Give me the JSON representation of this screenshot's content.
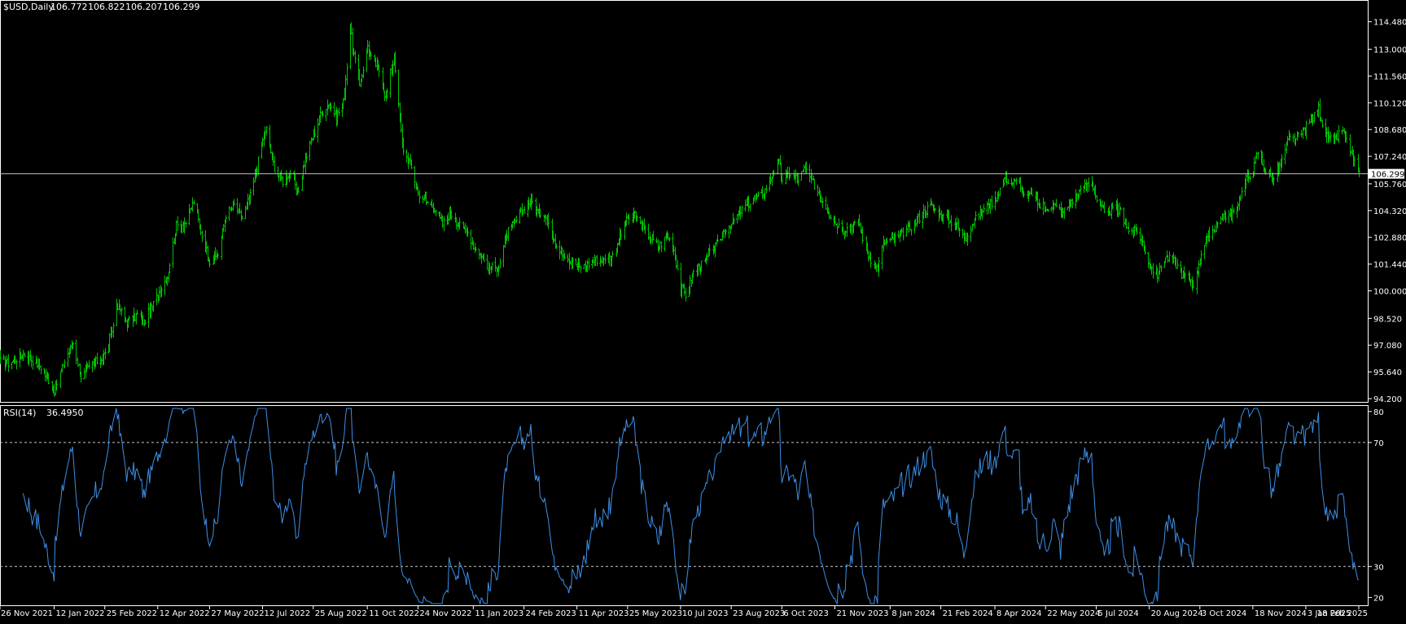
{
  "header": {
    "symbol_label": "$USD,Daily",
    "open": "106.772",
    "high": "106.822",
    "low": "106.207",
    "close": "106.299"
  },
  "indicator": {
    "label": "RSI(14)",
    "value": "36.4950"
  },
  "colors": {
    "background": "#000000",
    "bars": "#00c000",
    "rsi_line": "#3d8fe6",
    "axis": "#ffffff",
    "grid_levels": "#c8c8c8"
  },
  "chart_data": [
    {
      "type": "ohlc",
      "series_name": "$USD,Daily",
      "x_labels": [
        "26 Nov 2021",
        "12 Jan 2022",
        "25 Feb 2022",
        "12 Apr 2022",
        "27 May 2022",
        "12 Jul 2022",
        "25 Aug 2022",
        "11 Oct 2022",
        "24 Nov 2022",
        "11 Jan 2023",
        "24 Feb 2023",
        "11 Apr 2023",
        "25 May 2023",
        "10 Jul 2023",
        "23 Aug 2023",
        "6 Oct 2023",
        "21 Nov 2023",
        "8 Jan 2024",
        "21 Feb 2024",
        "8 Apr 2024",
        "22 May 2024",
        "5 Jul 2024",
        "20 Aug 2024",
        "3 Oct 2024",
        "18 Nov 2024",
        "3 Jan 2025",
        "18 Feb 2025"
      ],
      "y_ticks": [
        "114.480",
        "113.000",
        "111.560",
        "110.120",
        "108.680",
        "107.240",
        "105.760",
        "104.320",
        "102.880",
        "101.440",
        "100.000",
        "98.520",
        "97.080",
        "95.640",
        "94.200"
      ],
      "ylim": [
        94.2,
        115.3
      ],
      "current_price": "106.299",
      "close_anchors": [
        [
          "26 Nov 2021",
          96.2
        ],
        [
          "3 Dec 2021",
          96.1
        ],
        [
          "17 Dec 2021",
          96.6
        ],
        [
          "31 Dec 2021",
          95.9
        ],
        [
          "12 Jan 2022",
          94.7
        ],
        [
          "21 Jan 2022",
          96.2
        ],
        [
          "28 Jan 2022",
          97.2
        ],
        [
          "4 Feb 2022",
          95.4
        ],
        [
          "14 Feb 2022",
          96.0
        ],
        [
          "25 Feb 2022",
          96.6
        ],
        [
          "4 Mar 2022",
          98.1
        ],
        [
          "7 Mar 2022",
          99.3
        ],
        [
          "16 Mar 2022",
          98.3
        ],
        [
          "25 Mar 2022",
          98.7
        ],
        [
          "31 Mar 2022",
          98.3
        ],
        [
          "12 Apr 2022",
          99.8
        ],
        [
          "20 Apr 2022",
          100.8
        ],
        [
          "28 Apr 2022",
          103.5
        ],
        [
          "6 May 2022",
          103.7
        ],
        [
          "13 May 2022",
          104.8
        ],
        [
          "20 May 2022",
          103.0
        ],
        [
          "27 May 2022",
          101.6
        ],
        [
          "3 Jun 2022",
          102.0
        ],
        [
          "10 Jun 2022",
          104.1
        ],
        [
          "17 Jun 2022",
          104.6
        ],
        [
          "24 Jun 2022",
          103.9
        ],
        [
          "1 Jul 2022",
          105.1
        ],
        [
          "12 Jul 2022",
          108.1
        ],
        [
          "15 Jul 2022",
          108.7
        ],
        [
          "22 Jul 2022",
          106.6
        ],
        [
          "29 Jul 2022",
          105.9
        ],
        [
          "5 Aug 2022",
          106.4
        ],
        [
          "11 Aug 2022",
          105.1
        ],
        [
          "17 Aug 2022",
          106.9
        ],
        [
          "25 Aug 2022",
          108.4
        ],
        [
          "1 Sep 2022",
          109.6
        ],
        [
          "7 Sep 2022",
          110.1
        ],
        [
          "14 Sep 2022",
          109.4
        ],
        [
          "20 Sep 2022",
          110.1
        ],
        [
          "26 Sep 2022",
          114.2
        ],
        [
          "28 Sep 2022",
          113.0
        ],
        [
          "4 Oct 2022",
          111.1
        ],
        [
          "11 Oct 2022",
          113.2
        ],
        [
          "13 Oct 2022",
          112.6
        ],
        [
          "21 Oct 2022",
          111.9
        ],
        [
          "27 Oct 2022",
          110.4
        ],
        [
          "3 Nov 2022",
          112.7
        ],
        [
          "10 Nov 2022",
          107.8
        ],
        [
          "17 Nov 2022",
          106.8
        ],
        [
          "24 Nov 2022",
          105.3
        ],
        [
          "1 Dec 2022",
          104.8
        ],
        [
          "8 Dec 2022",
          104.5
        ],
        [
          "15 Dec 2022",
          103.6
        ],
        [
          "22 Dec 2022",
          104.2
        ],
        [
          "30 Dec 2022",
          103.5
        ],
        [
          "6 Jan 2023",
          103.2
        ],
        [
          "11 Jan 2023",
          102.4
        ],
        [
          "18 Jan 2023",
          101.8
        ],
        [
          "25 Jan 2023",
          101.2
        ],
        [
          "2 Feb 2023",
          101.3
        ],
        [
          "9 Feb 2023",
          103.1
        ],
        [
          "16 Feb 2023",
          103.7
        ],
        [
          "24 Feb 2023",
          104.4
        ],
        [
          "2 Mar 2023",
          104.9
        ],
        [
          "8 Mar 2023",
          104.2
        ],
        [
          "15 Mar 2023",
          104.1
        ],
        [
          "22 Mar 2023",
          102.6
        ],
        [
          "29 Mar 2023",
          102.1
        ],
        [
          "5 Apr 2023",
          101.6
        ],
        [
          "11 Apr 2023",
          101.4
        ],
        [
          "14 Apr 2023",
          101.3
        ],
        [
          "20 Apr 2023",
          101.4
        ],
        [
          "28 Apr 2023",
          101.7
        ],
        [
          "5 May 2023",
          101.6
        ],
        [
          "12 May 2023",
          101.9
        ],
        [
          "18 May 2023",
          102.9
        ],
        [
          "25 May 2023",
          103.9
        ],
        [
          "31 May 2023",
          104.1
        ],
        [
          "7 Jun 2023",
          103.4
        ],
        [
          "14 Jun 2023",
          102.8
        ],
        [
          "21 Jun 2023",
          102.4
        ],
        [
          "28 Jun 2023",
          102.9
        ],
        [
          "3 Jul 2023",
          102.6
        ],
        [
          "10 Jul 2023",
          100.1
        ],
        [
          "14 Jul 2023",
          99.8
        ],
        [
          "21 Jul 2023",
          101.0
        ],
        [
          "28 Jul 2023",
          101.4
        ],
        [
          "4 Aug 2023",
          102.0
        ],
        [
          "11 Aug 2023",
          102.5
        ],
        [
          "17 Aug 2023",
          103.3
        ],
        [
          "23 Aug 2023",
          103.6
        ],
        [
          "30 Aug 2023",
          104.2
        ],
        [
          "6 Sep 2023",
          104.7
        ],
        [
          "13 Sep 2023",
          104.9
        ],
        [
          "20 Sep 2023",
          105.3
        ],
        [
          "27 Sep 2023",
          106.2
        ],
        [
          "3 Oct 2023",
          106.9
        ],
        [
          "6 Oct 2023",
          106.0
        ],
        [
          "13 Oct 2023",
          106.3
        ],
        [
          "20 Oct 2023",
          106.0
        ],
        [
          "26 Oct 2023",
          106.6
        ],
        [
          "2 Nov 2023",
          105.8
        ],
        [
          "9 Nov 2023",
          105.0
        ],
        [
          "15 Nov 2023",
          104.3
        ],
        [
          "21 Nov 2023",
          103.7
        ],
        [
          "28 Nov 2023",
          103.3
        ],
        [
          "5 Dec 2023",
          103.5
        ],
        [
          "12 Dec 2023",
          103.6
        ],
        [
          "18 Dec 2023",
          102.2
        ],
        [
          "22 Dec 2023",
          101.7
        ],
        [
          "28 Dec 2023",
          101.2
        ],
        [
          "2 Jan 2024",
          102.6
        ],
        [
          "8 Jan 2024",
          102.7
        ],
        [
          "15 Jan 2024",
          102.9
        ],
        [
          "22 Jan 2024",
          103.3
        ],
        [
          "29 Jan 2024",
          103.6
        ],
        [
          "5 Feb 2024",
          104.2
        ],
        [
          "12 Feb 2024",
          104.6
        ],
        [
          "21 Feb 2024",
          104.0
        ],
        [
          "28 Feb 2024",
          103.8
        ],
        [
          "6 Mar 2024",
          103.5
        ],
        [
          "12 Mar 2024",
          102.8
        ],
        [
          "19 Mar 2024",
          103.6
        ],
        [
          "26 Mar 2024",
          104.2
        ],
        [
          "2 Apr 2024",
          104.6
        ],
        [
          "8 Apr 2024",
          104.9
        ],
        [
          "16 Apr 2024",
          106.1
        ],
        [
          "22 Apr 2024",
          105.8
        ],
        [
          "29 Apr 2024",
          105.9
        ],
        [
          "3 May 2024",
          105.0
        ],
        [
          "10 May 2024",
          105.3
        ],
        [
          "16 May 2024",
          104.6
        ],
        [
          "22 May 2024",
          104.5
        ],
        [
          "29 May 2024",
          104.6
        ],
        [
          "5 Jun 2024",
          104.2
        ],
        [
          "12 Jun 2024",
          104.7
        ],
        [
          "19 Jun 2024",
          105.2
        ],
        [
          "26 Jun 2024",
          105.7
        ],
        [
          "1 Jul 2024",
          105.9
        ],
        [
          "5 Jul 2024",
          104.9
        ],
        [
          "12 Jul 2024",
          104.1
        ],
        [
          "19 Jul 2024",
          104.4
        ],
        [
          "26 Jul 2024",
          104.3
        ],
        [
          "2 Aug 2024",
          103.2
        ],
        [
          "9 Aug 2024",
          103.2
        ],
        [
          "14 Aug 2024",
          102.6
        ],
        [
          "20 Aug 2024",
          101.4
        ],
        [
          "27 Aug 2024",
          100.9
        ],
        [
          "3 Sep 2024",
          101.8
        ],
        [
          "10 Sep 2024",
          101.6
        ],
        [
          "17 Sep 2024",
          100.9
        ],
        [
          "24 Sep 2024",
          100.6
        ],
        [
          "27 Sep 2024",
          100.4
        ],
        [
          "30 Sep 2024",
          100.8
        ],
        [
          "3 Oct 2024",
          101.9
        ],
        [
          "10 Oct 2024",
          102.9
        ],
        [
          "16 Oct 2024",
          103.4
        ],
        [
          "23 Oct 2024",
          104.1
        ],
        [
          "30 Oct 2024",
          104.0
        ],
        [
          "6 Nov 2024",
          104.9
        ],
        [
          "12 Nov 2024",
          106.0
        ],
        [
          "18 Nov 2024",
          106.5
        ],
        [
          "22 Nov 2024",
          107.5
        ],
        [
          "28 Nov 2024",
          106.5
        ],
        [
          "5 Dec 2024",
          106.0
        ],
        [
          "12 Dec 2024",
          106.8
        ],
        [
          "19 Dec 2024",
          108.2
        ],
        [
          "26 Dec 2024",
          108.2
        ],
        [
          "3 Jan 2025",
          108.8
        ],
        [
          "10 Jan 2025",
          109.4
        ],
        [
          "14 Jan 2025",
          109.8
        ],
        [
          "20 Jan 2025",
          108.3
        ],
        [
          "27 Jan 2025",
          108.0
        ],
        [
          "3 Feb 2025",
          108.7
        ],
        [
          "10 Feb 2025",
          107.6
        ],
        [
          "13 Feb 2025",
          107.0
        ],
        [
          "18 Feb 2025",
          106.3
        ]
      ]
    },
    {
      "type": "line",
      "series_name": "RSI(14)",
      "y_ticks": [
        "80",
        "70",
        "30",
        "20"
      ],
      "levels": [
        70,
        30
      ],
      "ylim": [
        18,
        81
      ],
      "current_value": "36.4950"
    }
  ]
}
